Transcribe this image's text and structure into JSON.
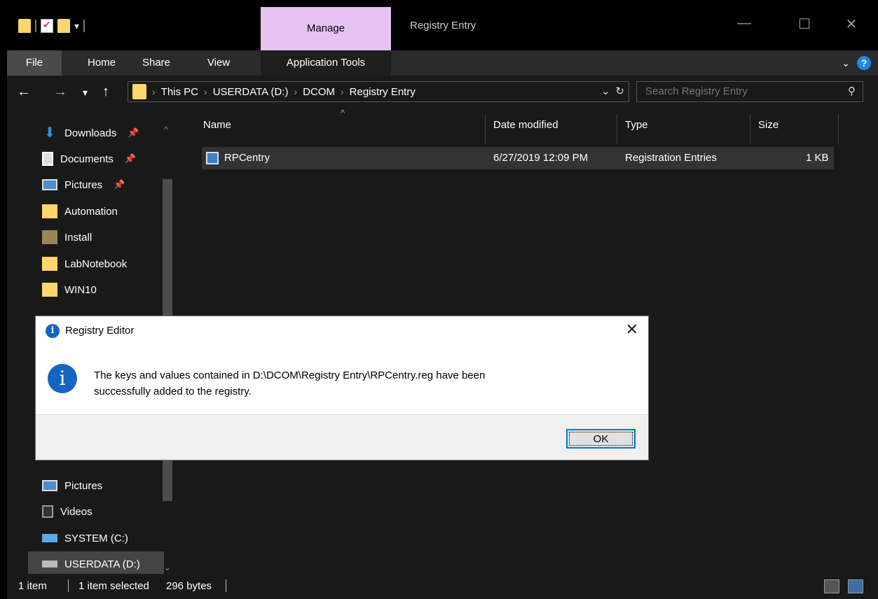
{
  "window": {
    "title": "Registry Entry",
    "manage_tab": "Manage"
  },
  "ribbon": {
    "tabs": [
      "File",
      "Home",
      "Share",
      "View",
      "Application Tools"
    ]
  },
  "address": {
    "breadcrumbs": [
      "This PC",
      "USERDATA (D:)",
      "DCOM",
      "Registry Entry"
    ],
    "search_placeholder": "Search Registry Entry"
  },
  "sidebar": {
    "items": [
      {
        "label": "Downloads",
        "icon": "download-icon",
        "pinned": true
      },
      {
        "label": "Documents",
        "icon": "documents-icon",
        "pinned": true
      },
      {
        "label": "Pictures",
        "icon": "pictures-icon",
        "pinned": true
      },
      {
        "label": "Automation",
        "icon": "folder-icon"
      },
      {
        "label": "Install",
        "icon": "folder-icon"
      },
      {
        "label": "LabNotebook",
        "icon": "folder-icon"
      },
      {
        "label": "WIN10",
        "icon": "folder-icon"
      },
      {
        "label": "Pictures",
        "icon": "pictures-icon"
      },
      {
        "label": "Videos",
        "icon": "videos-icon"
      },
      {
        "label": "SYSTEM (C:)",
        "icon": "system-drive-icon"
      },
      {
        "label": "USERDATA (D:)",
        "icon": "drive-icon",
        "selected": true
      }
    ]
  },
  "filelist": {
    "columns": [
      "Name",
      "Date modified",
      "Type",
      "Size"
    ],
    "rows": [
      {
        "name": "RPCentry",
        "date": "6/27/2019 12:09 PM",
        "type": "Registration Entries",
        "size": "1 KB"
      }
    ]
  },
  "status": {
    "count": "1 item",
    "selected": "1 item selected",
    "size": "296 bytes"
  },
  "dialog": {
    "title": "Registry Editor",
    "message_line1": "The keys and values contained in D:\\DCOM\\Registry Entry\\RPCentry.reg have been",
    "message_line2": "successfully added to the registry.",
    "ok_label": "OK"
  },
  "colors": {
    "manage_tab": "#e6c3f3",
    "accent": "#0078d7",
    "info": "#1565c0"
  }
}
